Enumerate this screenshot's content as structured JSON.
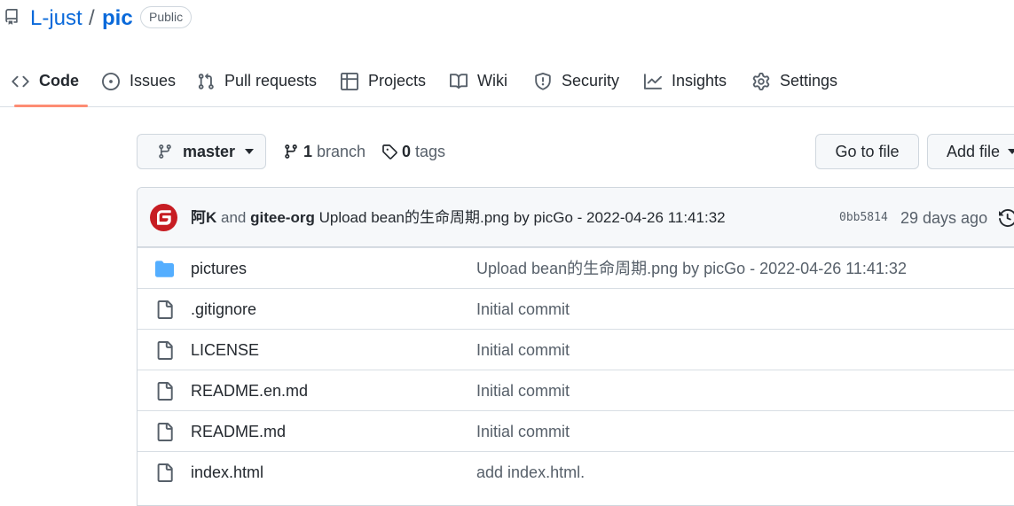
{
  "repo": {
    "owner": "L-just",
    "separator": "/",
    "name": "pic",
    "visibility": "Public"
  },
  "nav": {
    "tabs": [
      {
        "label": "Code",
        "icon": "code-icon",
        "selected": true
      },
      {
        "label": "Issues",
        "icon": "issue-opened-icon"
      },
      {
        "label": "Pull requests",
        "icon": "git-pull-request-icon"
      },
      {
        "label": "Projects",
        "icon": "table-icon"
      },
      {
        "label": "Wiki",
        "icon": "book-icon"
      },
      {
        "label": "Security",
        "icon": "shield-icon"
      },
      {
        "label": "Insights",
        "icon": "graph-icon"
      },
      {
        "label": "Settings",
        "icon": "gear-icon"
      }
    ]
  },
  "branch_bar": {
    "branch_name": "master",
    "branch_count": "1",
    "branch_label": "branch",
    "tag_count": "0",
    "tag_label": "tags",
    "go_to_file": "Go to file",
    "add_file": "Add file"
  },
  "latest_commit": {
    "author": "阿K",
    "and_text": "and",
    "coauthor": "gitee-org",
    "message": "Upload bean的生命周期.png by picGo - 2022-04-26 11:41:32",
    "sha": "0bb5814",
    "age": "29 days ago"
  },
  "files": [
    {
      "type": "folder",
      "icon": "file-directory-icon",
      "name": "pictures",
      "message": "Upload bean的生命周期.png by picGo - 2022-04-26 11:41:32"
    },
    {
      "type": "file",
      "icon": "file-icon",
      "name": ".gitignore",
      "message": "Initial commit"
    },
    {
      "type": "file",
      "icon": "file-icon",
      "name": "LICENSE",
      "message": "Initial commit"
    },
    {
      "type": "file",
      "icon": "file-icon",
      "name": "README.en.md",
      "message": "Initial commit"
    },
    {
      "type": "file",
      "icon": "file-icon",
      "name": "README.md",
      "message": "Initial commit"
    },
    {
      "type": "file",
      "icon": "file-icon",
      "name": "index.html",
      "message": "add index.html."
    }
  ],
  "colors": {
    "link": "#0969da",
    "selected_tab_underline": "#fd8c73",
    "folder": "#54aeff",
    "gitee_brand": "#c71d23"
  }
}
